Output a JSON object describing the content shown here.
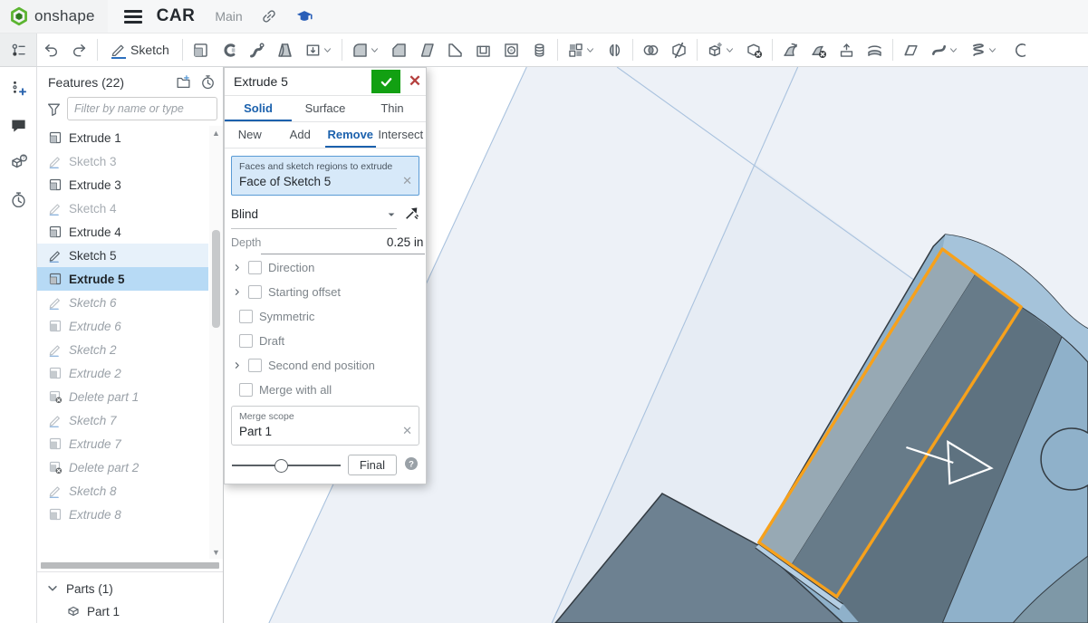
{
  "topbar": {
    "logo_text": "onshape",
    "document_title": "CAR",
    "workspace": "Main"
  },
  "toolbar": {
    "sketch_label": "Sketch",
    "items": [
      {
        "type": "icon",
        "name": "feature-list-toggle",
        "first": true
      },
      {
        "type": "icon",
        "name": "undo"
      },
      {
        "type": "icon",
        "name": "redo"
      },
      {
        "type": "sep"
      },
      {
        "type": "button",
        "name": "sketch"
      },
      {
        "type": "sep"
      },
      {
        "type": "icon",
        "name": "extrude"
      },
      {
        "type": "icon",
        "name": "revolve"
      },
      {
        "type": "icon",
        "name": "sweep"
      },
      {
        "type": "icon",
        "name": "loft"
      },
      {
        "type": "icon",
        "name": "thicken",
        "chevron": true
      },
      {
        "type": "sep"
      },
      {
        "type": "icon",
        "name": "fillet",
        "chevron": true
      },
      {
        "type": "icon",
        "name": "chamfer"
      },
      {
        "type": "icon",
        "name": "draft"
      },
      {
        "type": "icon",
        "name": "rib"
      },
      {
        "type": "icon",
        "name": "shell"
      },
      {
        "type": "icon",
        "name": "hole"
      },
      {
        "type": "icon",
        "name": "thread"
      },
      {
        "type": "sep"
      },
      {
        "type": "icon",
        "name": "linear-pattern",
        "chevron": true
      },
      {
        "type": "icon",
        "name": "mirror"
      },
      {
        "type": "sep"
      },
      {
        "type": "icon",
        "name": "boolean"
      },
      {
        "type": "icon",
        "name": "split"
      },
      {
        "type": "sep"
      },
      {
        "type": "icon",
        "name": "transform",
        "chevron": true
      },
      {
        "type": "icon",
        "name": "delete-part"
      },
      {
        "type": "sep"
      },
      {
        "type": "icon",
        "name": "move-face"
      },
      {
        "type": "icon",
        "name": "delete-face"
      },
      {
        "type": "icon",
        "name": "replace-face"
      },
      {
        "type": "icon",
        "name": "offset-surface"
      },
      {
        "type": "sep"
      },
      {
        "type": "icon",
        "name": "plane"
      },
      {
        "type": "icon",
        "name": "fill-surface",
        "chevron": true
      },
      {
        "type": "icon",
        "name": "helix",
        "chevron": true
      },
      {
        "type": "icon",
        "name": "curve"
      }
    ]
  },
  "left_rail": {
    "items": [
      {
        "name": "insert-plus"
      },
      {
        "name": "comment"
      },
      {
        "name": "featurescript-help"
      },
      {
        "name": "stopwatch"
      }
    ]
  },
  "features_panel": {
    "title": "Features (22)",
    "filter_placeholder": "Filter by name or type",
    "items": [
      {
        "label": "Extrude 1",
        "icon": "extrude-f",
        "state": "normal"
      },
      {
        "label": "Sketch 3",
        "icon": "sketch-f",
        "state": "hidden"
      },
      {
        "label": "Extrude 3",
        "icon": "extrude-f",
        "state": "normal"
      },
      {
        "label": "Sketch 4",
        "icon": "sketch-f",
        "state": "hidden"
      },
      {
        "label": "Extrude 4",
        "icon": "extrude-f",
        "state": "normal"
      },
      {
        "label": "Sketch 5",
        "icon": "sketch-f",
        "state": "preselect"
      },
      {
        "label": "Extrude 5",
        "icon": "extrude-f",
        "state": "selected"
      },
      {
        "label": "Sketch 6",
        "icon": "sketch-f",
        "state": "rolled"
      },
      {
        "label": "Extrude 6",
        "icon": "extrude-f",
        "state": "rolled"
      },
      {
        "label": "Sketch 2",
        "icon": "sketch-f",
        "state": "rolled"
      },
      {
        "label": "Extrude 2",
        "icon": "extrude-f",
        "state": "rolled"
      },
      {
        "label": "Delete part 1",
        "icon": "delete-f",
        "state": "rolled"
      },
      {
        "label": "Sketch 7",
        "icon": "sketch-f",
        "state": "rolled"
      },
      {
        "label": "Extrude 7",
        "icon": "extrude-f",
        "state": "rolled"
      },
      {
        "label": "Delete part 2",
        "icon": "delete-f",
        "state": "rolled"
      },
      {
        "label": "Sketch 8",
        "icon": "sketch-f",
        "state": "rolled"
      },
      {
        "label": "Extrude 8",
        "icon": "extrude-f",
        "state": "rolled"
      }
    ],
    "parts_title": "Parts (1)",
    "parts": [
      {
        "label": "Part 1"
      }
    ]
  },
  "dialog": {
    "title": "Extrude 5",
    "tabs": [
      "Solid",
      "Surface",
      "Thin"
    ],
    "active_tab": "Solid",
    "bool_tabs": [
      "New",
      "Add",
      "Remove",
      "Intersect"
    ],
    "active_bool": "Remove",
    "selection_label": "Faces and sketch regions to extrude",
    "selection_value": "Face of Sketch 5",
    "end_type": "Blind",
    "depth_label": "Depth",
    "depth_value": "0.25 in",
    "options": [
      {
        "label": "Direction",
        "expandable": true
      },
      {
        "label": "Starting offset",
        "expandable": true
      },
      {
        "label": "Symmetric",
        "expandable": false
      },
      {
        "label": "Draft",
        "expandable": false
      },
      {
        "label": "Second end position",
        "expandable": true
      },
      {
        "label": "Merge with all",
        "expandable": false
      }
    ],
    "merge_scope_label": "Merge scope",
    "merge_scope_value": "Part 1",
    "final_label": "Final",
    "slider_percent": 45
  },
  "viewport": {
    "colors": {
      "plane": "#edf1f7",
      "plane_overlap": "#e6ecf4",
      "plane_line": "#a9c2de",
      "body": "#8fb1ca",
      "body_top": "#a5c3da",
      "pocket_light": "#97a9b4",
      "pocket_dark": "#677b89",
      "pocket_dark2": "#5e7280",
      "slab": "#6d8191",
      "sliver": "#b5cfe4",
      "corner": "#7e98a7",
      "outline": "#333b42",
      "highlight": "#f7a11b",
      "arrow": "#ffffff",
      "accent_green": "#12a012",
      "accent_red": "#b5413f",
      "accent_blue": "#1b61ad"
    }
  }
}
